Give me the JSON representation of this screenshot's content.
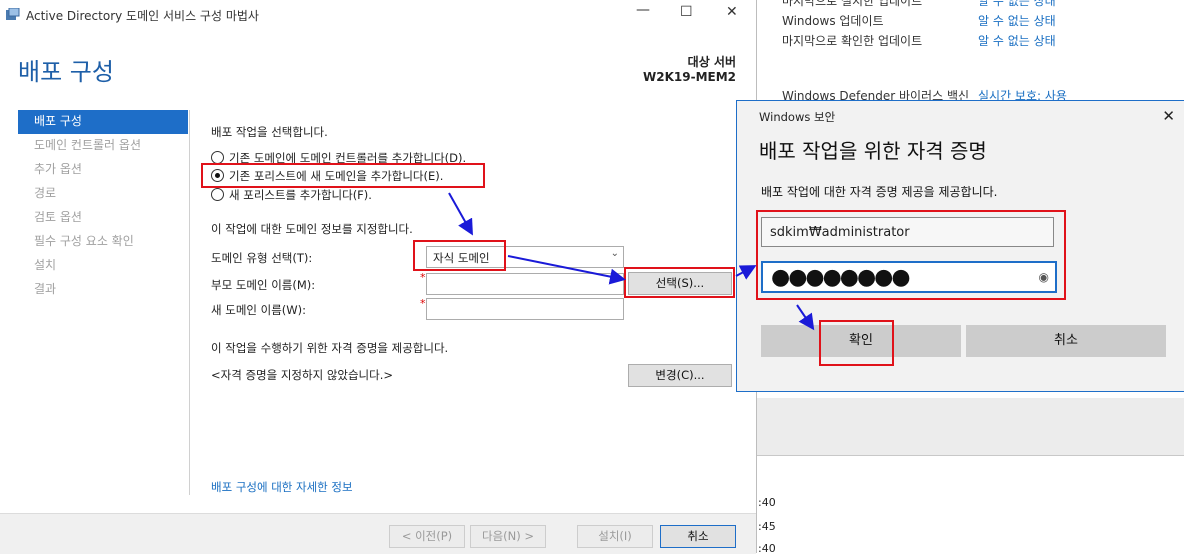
{
  "background": {
    "rows": [
      {
        "label": "마지막으로 설치한 업데이트",
        "value": "알 수 없는 상태"
      },
      {
        "label": "Windows 업데이트",
        "value": "알 수 없는 상태"
      },
      {
        "label": "마지막으로 확인한 업데이트",
        "value": "알 수 없는 상태"
      },
      {
        "label": "Windows Defender 바이러스 백신",
        "value": "실시간 보호: 사용"
      }
    ],
    "times": [
      ":40",
      ":45",
      ":40"
    ]
  },
  "wizard": {
    "window_title": "Active Directory 도메인 서비스 구성 마법사",
    "page_title": "배포 구성",
    "target_label": "대상 서버",
    "target_name": "W2K19-MEM2",
    "nav": [
      "배포 구성",
      "도메인 컨트롤러 옵션",
      "추가 옵션",
      "경로",
      "검토 옵션",
      "필수 구성 요소 확인",
      "설치",
      "결과"
    ],
    "select_op_label": "배포 작업을 선택합니다.",
    "options": [
      {
        "label": "기존 도메인에 도메인 컨트롤러를 추가합니다(D).",
        "selected": false
      },
      {
        "label": "기존 포리스트에 새 도메인을 추가합니다(E).",
        "selected": true
      },
      {
        "label": "새 포리스트를 추가합니다(F).",
        "selected": false
      }
    ],
    "domain_info_label": "이 작업에 대한 도메인 정보를 지정합니다.",
    "domain_type_label": "도메인 유형 선택(T):",
    "domain_type_value": "자식 도메인",
    "parent_domain_label": "부모 도메인 이름(M):",
    "new_domain_label": "새 도메인 이름(W):",
    "select_button": "선택(S)...",
    "credentials_prompt": "이 작업을 수행하기 위한 자격 증명을 제공합니다.",
    "credentials_status": "<자격 증명을 지정하지 않았습니다.>",
    "change_button": "변경(C)...",
    "more_link": "배포 구성에 대한 자세한 정보",
    "footer": {
      "prev": "< 이전(P)",
      "next": "다음(N) >",
      "install": "설치(I)",
      "cancel": "취소"
    }
  },
  "credential_dialog": {
    "title": "Windows 보안",
    "heading": "배포 작업을 위한 자격 증명",
    "description": "배포 작업에 대한 자격 증명 제공을 제공합니다.",
    "username": "sdkim₩administrator",
    "password_mask": "●●●●●●●●",
    "ok": "확인",
    "cancel": "취소"
  },
  "colors": {
    "accent": "#1e6ec8",
    "highlight": "#e0121a",
    "arrow": "#1a1ad8"
  }
}
